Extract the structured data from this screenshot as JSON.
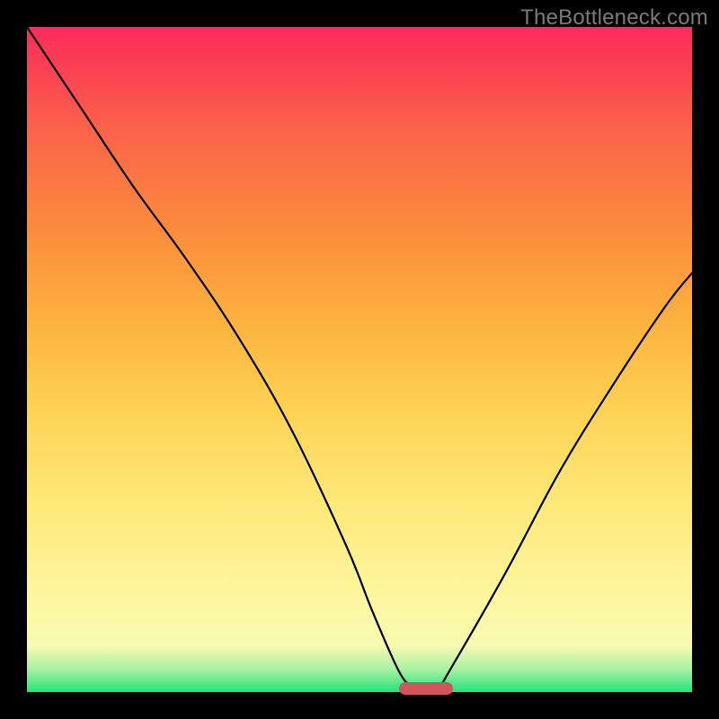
{
  "watermark": "TheBottleneck.com",
  "chart_data": {
    "type": "line",
    "title": "",
    "xlabel": "",
    "ylabel": "",
    "xlim": [
      0,
      100
    ],
    "ylim": [
      0,
      100
    ],
    "grid": false,
    "legend": false,
    "series": [
      {
        "name": "bottleneck-curve",
        "x": [
          0,
          8,
          16,
          24,
          32,
          40,
          48,
          52,
          56,
          58,
          60,
          62,
          64,
          72,
          80,
          88,
          96,
          100
        ],
        "values": [
          100,
          88,
          76,
          65,
          53,
          39,
          22,
          12,
          3,
          1,
          1,
          1,
          4,
          18,
          33,
          46,
          58,
          63
        ]
      }
    ],
    "marker": {
      "name": "optimal-range",
      "x_start": 56,
      "x_end": 64,
      "y": 0.5,
      "color": "#d0565c"
    },
    "gradient_stops": [
      {
        "pos": 0,
        "color": "#22e57c"
      },
      {
        "pos": 3.5,
        "color": "#a8f2a4"
      },
      {
        "pos": 7,
        "color": "#f6fbb0"
      },
      {
        "pos": 14,
        "color": "#fef6a0"
      },
      {
        "pos": 28,
        "color": "#fee97a"
      },
      {
        "pos": 42,
        "color": "#fed355"
      },
      {
        "pos": 56,
        "color": "#fcb13e"
      },
      {
        "pos": 70,
        "color": "#fb8b3c"
      },
      {
        "pos": 84,
        "color": "#fb6449"
      },
      {
        "pos": 100,
        "color": "#fb2b5a"
      }
    ]
  }
}
